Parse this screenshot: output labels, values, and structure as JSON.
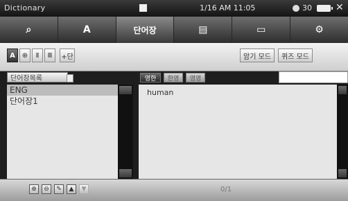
{
  "status": {
    "title": "Dictionary",
    "clock": "1/16 AM 11:05",
    "volume": "30"
  },
  "toolbar": {
    "items": [
      {
        "name": "search-icon",
        "glyph": "⌕"
      },
      {
        "name": "font-icon",
        "glyph": "A"
      },
      {
        "name": "tab-wordbook",
        "glyph": "단어장"
      },
      {
        "name": "list-icon",
        "glyph": "▤"
      },
      {
        "name": "window-icon",
        "glyph": "▭"
      },
      {
        "name": "settings-icon",
        "glyph": "⚙"
      }
    ]
  },
  "modes": {
    "left": [
      "A",
      "⊕",
      "Ⅱ",
      "Ⅲ",
      "+단"
    ],
    "right": [
      "암기 모드",
      "퀴즈 모드"
    ]
  },
  "left": {
    "tab": "단어장목록",
    "items": [
      "ENG",
      "단어장1"
    ]
  },
  "right": {
    "tabs": [
      "영한",
      "한영",
      "영영"
    ],
    "word": "human"
  },
  "bottom": {
    "icons": [
      "⊕",
      "⊖",
      "✎",
      "▲",
      "▼"
    ],
    "center": "0/1"
  }
}
